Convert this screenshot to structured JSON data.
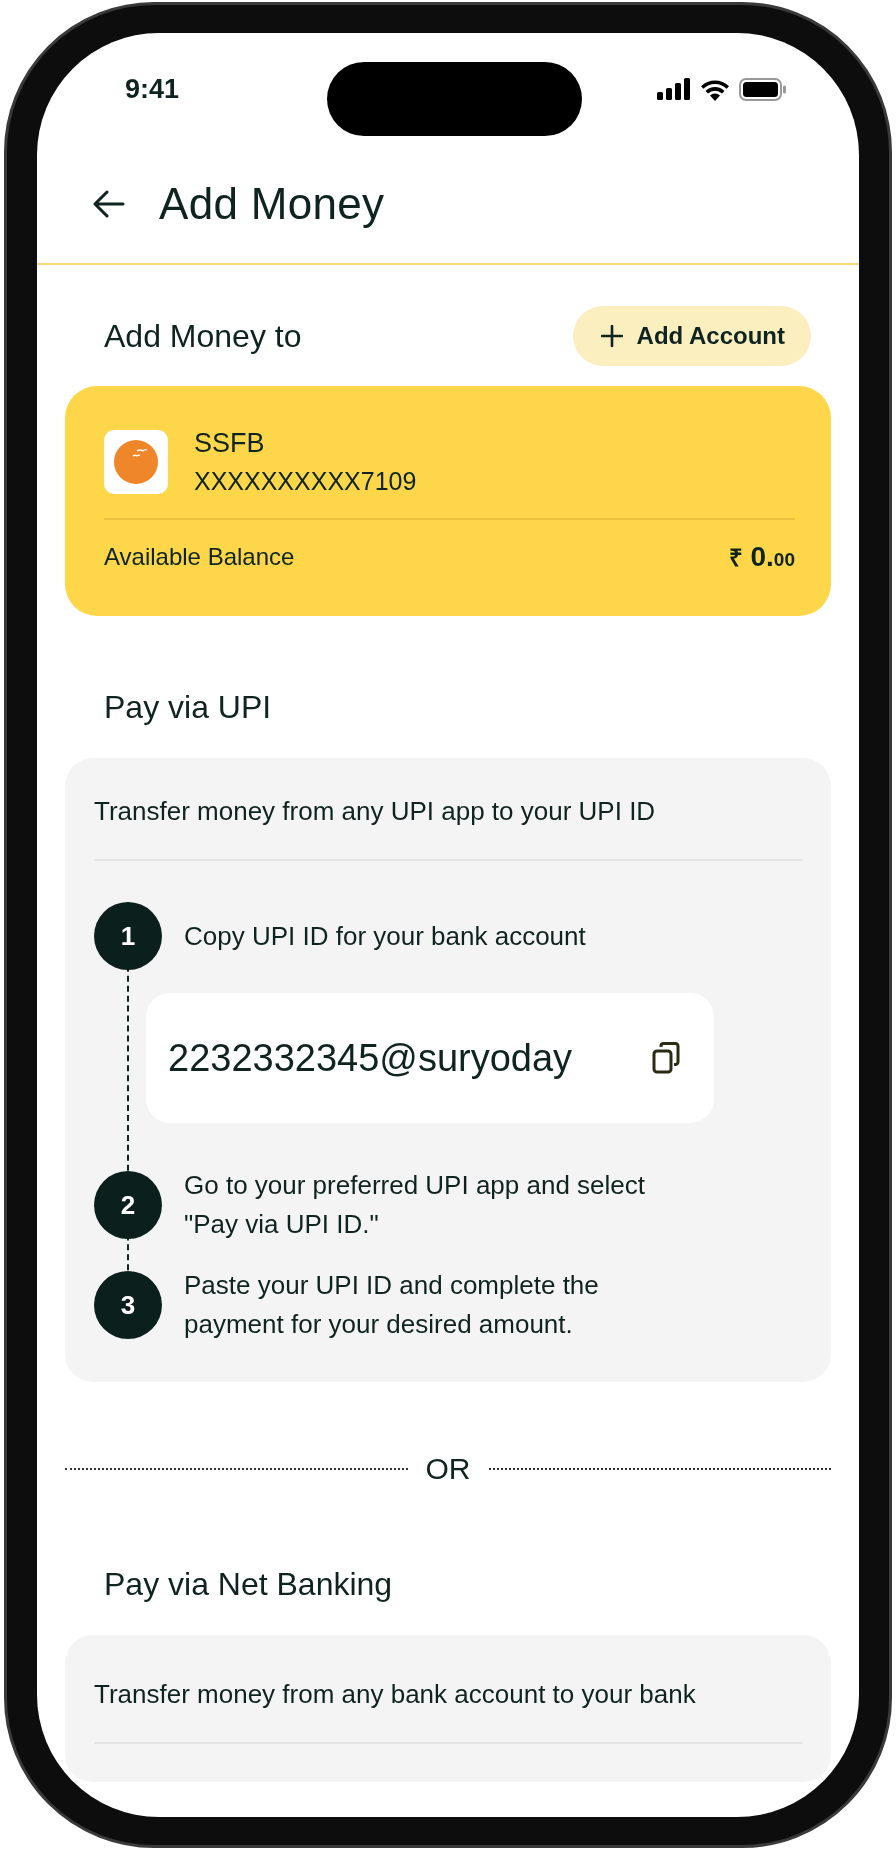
{
  "status_bar": {
    "time": "9:41"
  },
  "header": {
    "title": "Add Money"
  },
  "add_money_to": {
    "heading": "Add Money to",
    "add_account_button": "Add Account"
  },
  "account_card": {
    "bank_name": "SSFB",
    "account_number": "XXXXXXXXXX7109",
    "balance_label": "Available Balance",
    "currency": "₹",
    "balance_whole": "0.",
    "balance_fraction": "00"
  },
  "upi": {
    "heading": "Pay via UPI",
    "intro": "Transfer money from any UPI app to your UPI ID",
    "steps": [
      {
        "number": "1",
        "text": "Copy UPI ID for your bank account",
        "upi_id": "2232332345@suryoday"
      },
      {
        "number": "2",
        "text": "Go to your preferred UPI app and select \"Pay via UPI ID.\""
      },
      {
        "number": "3",
        "text": "Paste your UPI ID and complete the payment for your desired amount."
      }
    ]
  },
  "separator": {
    "label": "OR"
  },
  "net_banking": {
    "heading": "Pay via Net Banking",
    "intro": "Transfer money from any bank account to your bank"
  }
}
